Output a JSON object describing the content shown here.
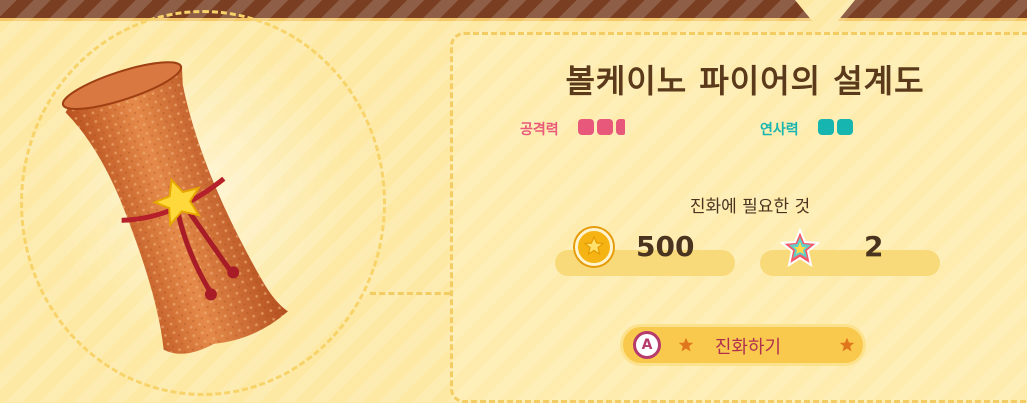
{
  "item": {
    "title": "볼케이노 파이어의 설계도",
    "image": "blueprint-scroll"
  },
  "stats": {
    "attack": {
      "label": "공격력",
      "level": 2.5,
      "max": 3,
      "color": "#e8587a"
    },
    "rapid_fire": {
      "label": "연사력",
      "level": 2,
      "max": 2,
      "color": "#17b5b0"
    }
  },
  "evolve": {
    "requirement_label": "진화에 필요한 것",
    "coin_icon": "star-coin-icon",
    "coin_count": "500",
    "rare_stone_icon": "rainbow-star-icon",
    "rare_stone_count": "2",
    "button_key": "A",
    "button_label": "진화하기"
  },
  "colors": {
    "background": "#fde9a3",
    "top_bar": "#7a3f22",
    "title": "#5a3a1a",
    "button": "#f9c94d",
    "button_text": "#b2304f"
  }
}
